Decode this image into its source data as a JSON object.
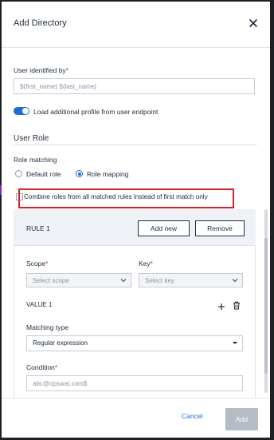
{
  "dialog": {
    "title": "Add Directory"
  },
  "user_identified": {
    "label": "User identified by",
    "required_mark": "*",
    "value": "${first_name} ${last_name}"
  },
  "load_profile": {
    "label": "Load additional profile from user endpoint",
    "enabled": true
  },
  "user_role": {
    "section_title": "User Role",
    "role_matching_label": "Role matching",
    "options": [
      "Default role",
      "Role mapping"
    ],
    "selected": "Role mapping",
    "combine_label": "Combine roles from all matched rules instead of first match only",
    "combine_checked": false
  },
  "rule": {
    "title": "RULE 1",
    "add_new_label": "Add new",
    "remove_label": "Remove",
    "scope_label": "Scope",
    "scope_placeholder": "Select scope",
    "key_label": "Key",
    "key_placeholder": "Select key",
    "required_mark": "*",
    "value_title": "VALUE 1",
    "matching_type_label": "Matching type",
    "matching_type_value": "Regular expression",
    "condition_label": "Condition",
    "condition_placeholder": "abc@opswat.com$"
  },
  "footer": {
    "cancel_label": "Cancel",
    "add_label": "Add"
  },
  "colors": {
    "accent": "#1e6bd6",
    "highlight": "#d0262b",
    "required": "#d0312d",
    "disabled_button": "#b4bcc6"
  }
}
